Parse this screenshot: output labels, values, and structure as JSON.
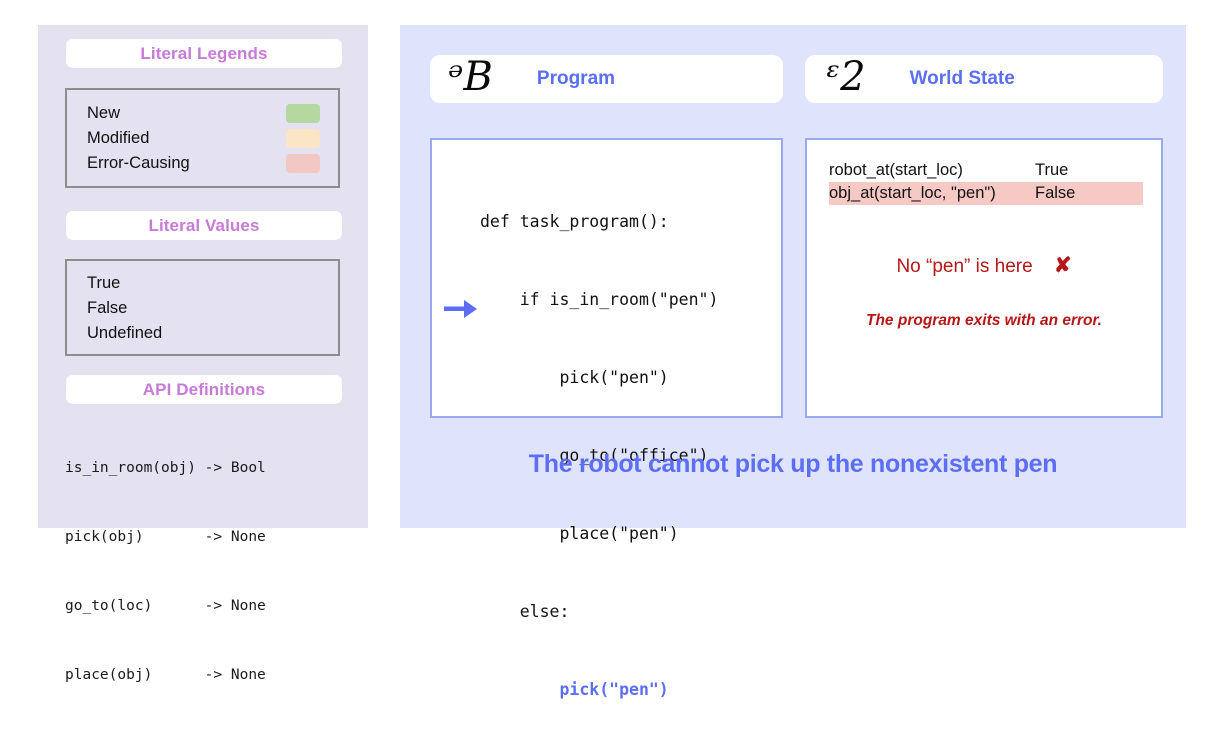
{
  "left_panel": {
    "legend_section": {
      "header": "Literal Legends",
      "items": [
        {
          "label": "New",
          "color": "#b5d8a1"
        },
        {
          "label": "Modified",
          "color": "#fce5c6"
        },
        {
          "label": "Error-Causing",
          "color": "#f2c8c5"
        }
      ]
    },
    "values_section": {
      "header": "Literal Values",
      "items": [
        "True",
        "False",
        "Undefined"
      ]
    },
    "api_section": {
      "header": "API Definitions",
      "lines": [
        "is_in_room(obj) -> Bool",
        "pick(obj)       -> None",
        "go_to(loc)      -> None",
        "place(obj)      -> None"
      ]
    }
  },
  "right_panel": {
    "program_column": {
      "glyph": "ᵊB",
      "title": "Program",
      "code_lines": [
        {
          "text": "def task_program():",
          "highlight": false,
          "current": false
        },
        {
          "text": "    if is_in_room(\"pen\")",
          "highlight": false,
          "current": false
        },
        {
          "text": "        pick(\"pen\")",
          "highlight": false,
          "current": false
        },
        {
          "text": "        go_to(\"office\")",
          "highlight": false,
          "current": false
        },
        {
          "text": "        place(\"pen\")",
          "highlight": false,
          "current": false
        },
        {
          "text": "    else:",
          "highlight": false,
          "current": false
        },
        {
          "text": "        pick(\"pen\")",
          "highlight": true,
          "current": true
        }
      ],
      "execution_pointer": "arrow-right-icon"
    },
    "world_column": {
      "glyph": "ᵋ2",
      "title": "World State",
      "state_rows": [
        {
          "predicate": "robot_at(start_loc)",
          "value": "True",
          "error": false
        },
        {
          "predicate": "obj_at(start_loc, \"pen\")",
          "value": "False",
          "error": true
        }
      ],
      "error_message": "No “pen” is here",
      "error_mark": "✘",
      "exit_message": "The program exits with an error."
    },
    "caption": "The robot cannot pick up the nonexistent pen"
  },
  "colors": {
    "left_panel_bg": "#e4e1f0",
    "right_panel_bg": "#dfe3fb",
    "header_text": "#c77ad8",
    "accent_blue": "#5b6ef5",
    "error_red": "#b71717",
    "error_row_bg": "#f6c9c5",
    "box_border_gray": "#8d8d8d",
    "box_border_blue": "#9aa8f2"
  }
}
